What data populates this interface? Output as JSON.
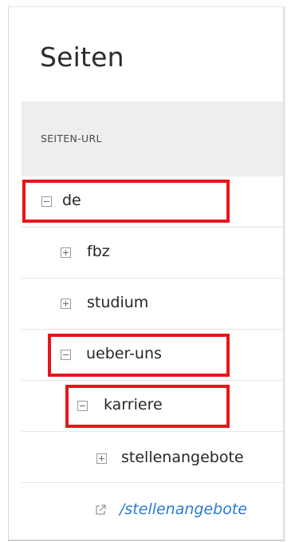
{
  "page": {
    "title": "Seiten"
  },
  "table": {
    "column_header": "SEITEN-URL"
  },
  "tree": {
    "de": {
      "label": "de",
      "state": "expanded",
      "icon": "minus-square-icon"
    },
    "fbz": {
      "label": "fbz",
      "state": "collapsed",
      "icon": "plus-square-icon"
    },
    "studium": {
      "label": "studium",
      "state": "collapsed",
      "icon": "plus-square-icon"
    },
    "ueber_uns": {
      "label": "ueber-uns",
      "state": "expanded",
      "icon": "minus-square-icon"
    },
    "karriere": {
      "label": "karriere",
      "state": "expanded",
      "icon": "minus-square-icon"
    },
    "stellenangebote": {
      "label": "stellenangebote",
      "state": "collapsed",
      "icon": "plus-square-icon"
    },
    "link": {
      "label": "/stellenangebote",
      "icon": "external-link-icon"
    }
  },
  "colors": {
    "highlight": "#e8141b",
    "link": "#2a7bd3",
    "header_bg": "#eeeeee"
  }
}
